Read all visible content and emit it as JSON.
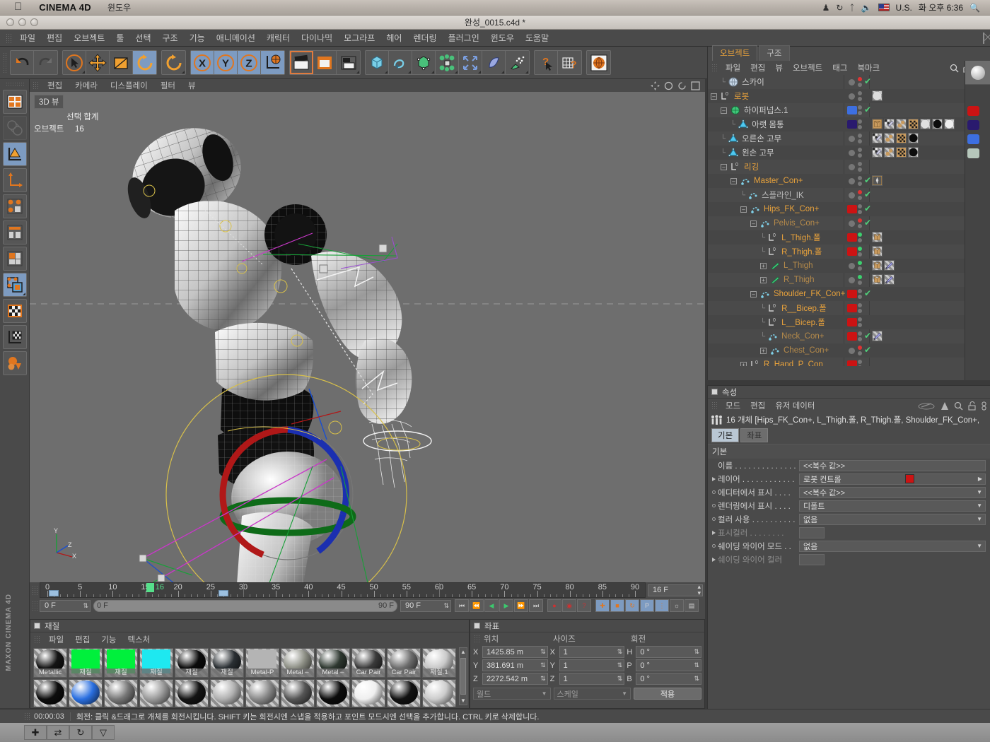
{
  "osx": {
    "apple_icon": "apple-icon",
    "app_name": "CINEMA 4D",
    "menu": [
      "윈도우"
    ],
    "status_icons": [
      "security-icon",
      "sync-icon",
      "bluetooth-icon",
      "volume-icon"
    ],
    "input_source": "U.S.",
    "clock": "화 오후 6:36",
    "spotlight": "search-icon"
  },
  "window": {
    "title": "완성_0015.c4d *"
  },
  "main_menu": [
    "파일",
    "편집",
    "오브젝트",
    "툴",
    "선택",
    "구조",
    "기능",
    "애니메이션",
    "캐릭터",
    "다이나믹",
    "모그라프",
    "헤어",
    "렌더링",
    "플러그인",
    "윈도우",
    "도움말"
  ],
  "toolbar": {
    "groups": [
      {
        "buttons": [
          {
            "name": "undo-icon",
            "state": "normal"
          },
          {
            "name": "redo-icon",
            "state": "disabled"
          }
        ]
      },
      {
        "buttons": [
          {
            "name": "select-tool-icon",
            "state": "normal"
          },
          {
            "name": "move-tool-icon",
            "state": "normal"
          },
          {
            "name": "scale-tool-icon",
            "state": "normal"
          },
          {
            "name": "rotate-tool-icon",
            "state": "active"
          }
        ]
      },
      {
        "buttons": [
          {
            "name": "rotate-alt-icon",
            "state": "normal"
          }
        ]
      },
      {
        "buttons": [
          {
            "name": "axis-x-icon",
            "state": "active"
          },
          {
            "name": "axis-y-icon",
            "state": "active"
          },
          {
            "name": "axis-z-icon",
            "state": "active"
          },
          {
            "name": "world-coordinate-icon",
            "state": "active"
          }
        ]
      },
      {
        "buttons": [
          {
            "name": "render-view-icon",
            "state": "highlight"
          },
          {
            "name": "render-region-icon",
            "state": "normal"
          },
          {
            "name": "render-settings-icon",
            "state": "normal"
          }
        ]
      },
      {
        "buttons": [
          {
            "name": "cube-primitive-icon",
            "state": "normal"
          },
          {
            "name": "spline-icon",
            "state": "normal"
          },
          {
            "name": "nurbs-icon",
            "state": "normal"
          },
          {
            "name": "array-icon",
            "state": "normal"
          },
          {
            "name": "deformer-icon",
            "state": "normal"
          },
          {
            "name": "environment-icon",
            "state": "normal"
          },
          {
            "name": "particles-icon",
            "state": "normal"
          }
        ]
      },
      {
        "buttons": [
          {
            "name": "help-cursor-icon",
            "state": "normal"
          },
          {
            "name": "layout-help-icon",
            "state": "normal"
          }
        ]
      },
      {
        "buttons": [
          {
            "name": "web-icon",
            "state": "normal"
          }
        ]
      }
    ]
  },
  "left_toolbar": [
    {
      "name": "layout-icon",
      "state": "normal"
    },
    {
      "name": "global-local-icon",
      "state": "disabled"
    },
    {
      "name": "model-mode-icon",
      "state": "active"
    },
    {
      "name": "object-axis-icon",
      "state": "normal"
    },
    {
      "name": "point-mode-icon",
      "state": "normal"
    },
    {
      "name": "edge-mode-icon",
      "state": "normal"
    },
    {
      "name": "polygon-mode-icon",
      "state": "normal"
    },
    {
      "name": "animation-mode-icon",
      "state": "active"
    },
    {
      "name": "texture-mode-icon",
      "state": "normal"
    },
    {
      "name": "texture-axis-icon",
      "state": "normal"
    },
    {
      "name": "workplane-icon",
      "state": "normal"
    }
  ],
  "maxon_logo": "MAXON CINEMA 4D",
  "viewport": {
    "menu": [
      "편집",
      "카메라",
      "디스플레이",
      "필터",
      "뷰"
    ],
    "label": "3D 뷰",
    "stats": {
      "header": "선택 합계",
      "rows": [
        {
          "key": "오브젝트",
          "value": "16"
        }
      ]
    },
    "axis_labels": [
      "Y",
      "X",
      "Z"
    ]
  },
  "timeline": {
    "ruler_ticks": [
      0,
      5,
      10,
      15,
      20,
      25,
      30,
      35,
      40,
      45,
      50,
      55,
      60,
      65,
      70,
      75,
      80,
      85,
      90
    ],
    "current_frame_label": "16",
    "current_frame_value": 16,
    "range_start": 0,
    "range_end": 90,
    "markers": [
      1,
      27
    ],
    "frame_field": "16 F",
    "start_field": "0 F",
    "preview_start": "0 F",
    "preview_end": "90 F",
    "end_field": "90 F",
    "transport": [
      "go-to-start-icon",
      "step-back-icon",
      "play-back-icon",
      "play-forward-icon",
      "step-forward-icon",
      "go-to-end-icon"
    ],
    "record": [
      "record-keyframe-icon",
      "autokey-icon",
      "keyframe-selection-icon"
    ],
    "keyflags": [
      "position-key-icon",
      "scale-key-icon",
      "rotation-key-icon",
      "param-key-icon",
      "point-level-key-icon",
      "animation-layer-icon",
      "keyframe-preset-icon"
    ]
  },
  "material_manager": {
    "title": "재질",
    "menu": [
      "파일",
      "편집",
      "기능",
      "텍스처"
    ],
    "rows": [
      [
        {
          "name": "Metallic",
          "type": "ball",
          "color": "#141414",
          "spec": "strong"
        },
        {
          "name": "재질",
          "type": "flat",
          "color": "#00f03c"
        },
        {
          "name": "재질",
          "type": "flat",
          "color": "#00f03c"
        },
        {
          "name": "재질",
          "type": "flat",
          "color": "#1ee8f0"
        },
        {
          "name": "재질",
          "type": "ball",
          "color": "#0b0b0b"
        },
        {
          "name": "재질",
          "type": "ball",
          "color": "#2a2f33"
        },
        {
          "name": "Metal-P",
          "type": "flat",
          "color": "#b4b4b4"
        },
        {
          "name": "Metal –",
          "type": "ball",
          "color": "#8d8f85"
        },
        {
          "name": "Metal –",
          "type": "ball",
          "color": "#2e3830"
        },
        {
          "name": "Car Pair",
          "type": "ball",
          "color": "#3a3a3a"
        },
        {
          "name": "Car Pair",
          "type": "ball",
          "color": "#6d6d6d"
        },
        {
          "name": "재질.1",
          "type": "ball",
          "color": "#c9c9c9"
        }
      ],
      [
        {
          "name": "",
          "type": "ball",
          "color": "#0d0d0d"
        },
        {
          "name": "",
          "type": "ball",
          "color": "#2a6fe0"
        },
        {
          "name": "",
          "type": "ball",
          "color": "#777777"
        },
        {
          "name": "",
          "type": "ball",
          "color": "#9a9a9a"
        },
        {
          "name": "",
          "type": "ball",
          "color": "#141414"
        },
        {
          "name": "",
          "type": "ball",
          "color": "#b0b0b0"
        },
        {
          "name": "",
          "type": "ball",
          "color": "#8a8a8a"
        },
        {
          "name": "",
          "type": "ball",
          "color": "#555555"
        },
        {
          "name": "",
          "type": "ball",
          "color": "#0c0c0c"
        },
        {
          "name": "",
          "type": "ball",
          "color": "#efefef"
        },
        {
          "name": "",
          "type": "ball",
          "color": "#121212"
        },
        {
          "name": "",
          "type": "ball",
          "color": "#cccccc"
        }
      ]
    ]
  },
  "coordinates": {
    "title": "좌표",
    "col_headers": [
      "위치",
      "사이즈",
      "회전"
    ],
    "position": {
      "x": "1425.85 m",
      "y": "381.691 m",
      "z": "2272.542 m"
    },
    "size": {
      "x": "1",
      "y": "1",
      "z": "1"
    },
    "rotation": {
      "h": "0 °",
      "p": "0 °",
      "b": "0 °"
    },
    "axis_labels": {
      "pos": [
        "X",
        "Y",
        "Z"
      ],
      "size": [
        "X",
        "Y",
        "Z"
      ],
      "rot": [
        "H",
        "P",
        "B"
      ]
    },
    "system_dropdown": "월드",
    "mode_dropdown": "스케일",
    "apply_button": "적용"
  },
  "object_manager": {
    "tabs": [
      {
        "label": "오브젝트",
        "active": true
      },
      {
        "label": "구조",
        "active": false
      }
    ],
    "menu": [
      "파일",
      "편집",
      "뷰",
      "오브젝트",
      "태그",
      "북마크"
    ],
    "menu_icons": [
      "search-icon",
      "home-icon",
      "eye-icon"
    ],
    "rows": [
      {
        "name": "스카이",
        "icon": "sky-icon",
        "indent": 1,
        "color": "#cfcfcf",
        "expander": "none",
        "chip": "none",
        "dots": "red",
        "check": true,
        "tags": []
      },
      {
        "name": "로봇",
        "icon": "null-object-icon",
        "indent": 0,
        "color": "#e8a23c",
        "expander": "minus",
        "chip": "none",
        "dots": "gray",
        "check": false,
        "tags": [
          "material-sphere"
        ]
      },
      {
        "name": "하이퍼넙스.1",
        "icon": "hypernurbs-icon",
        "indent": 1,
        "color": "#cfcfcf",
        "expander": "minus",
        "chip": "#3d6fe0",
        "dots": "gray",
        "check": true,
        "tags": []
      },
      {
        "name": "아랫 몸통",
        "icon": "polygon-object-icon",
        "indent": 2,
        "color": "#cfcfcf",
        "expander": "none",
        "chip": "#2a1a6e",
        "dots": "gray",
        "check": false,
        "tags": [
          "phong-icon",
          "texture-icon",
          "dot-pair-icon",
          "checker-icon",
          "mat-white",
          "mat-black",
          "mat-white2"
        ]
      },
      {
        "name": "오른손 고무",
        "icon": "polygon-object-icon",
        "indent": 1,
        "color": "#cfcfcf",
        "expander": "none",
        "chip": "none",
        "dots": "gray",
        "check": false,
        "tags": [
          "texture-icon",
          "dot-pair-icon",
          "checker-icon",
          "mat-black"
        ]
      },
      {
        "name": "왼손 고무",
        "icon": "polygon-object-icon",
        "indent": 1,
        "color": "#cfcfcf",
        "expander": "none",
        "chip": "none",
        "dots": "gray",
        "check": false,
        "tags": [
          "texture-icon",
          "dot-pair-icon",
          "checker-icon",
          "mat-black"
        ]
      },
      {
        "name": "리깅",
        "icon": "null-object-icon",
        "indent": 1,
        "color": "#e8a23c",
        "expander": "minus",
        "chip": "none",
        "dots": "gray",
        "check": false,
        "tags": []
      },
      {
        "name": "Master_Con+",
        "icon": "joint-icon",
        "indent": 2,
        "color": "#e8a23c",
        "expander": "minus",
        "chip": "none",
        "dots": "gray",
        "check": true,
        "tags": [
          "xpresso-icon"
        ]
      },
      {
        "name": "스플라인_IK",
        "icon": "joint-icon",
        "indent": 3,
        "color": "#bdbdbd",
        "expander": "none",
        "chip": "none",
        "dots": "red",
        "check": true,
        "tags": []
      },
      {
        "name": "Hips_FK_Con+",
        "icon": "joint-icon",
        "indent": 3,
        "color": "#e8a23c",
        "expander": "minus",
        "chip": "#cc1313",
        "dots": "gray",
        "check": true,
        "tags": []
      },
      {
        "name": "Pelvis_Con+",
        "icon": "joint-icon",
        "indent": 4,
        "color": "#b58a4a",
        "expander": "minus",
        "chip": "none",
        "dots": "red",
        "check": true,
        "tags": []
      },
      {
        "name": "L_Thigh.폴",
        "icon": "null-object-icon",
        "indent": 5,
        "color": "#e8a23c",
        "expander": "none",
        "chip": "#cc1313",
        "dots": "green",
        "check": false,
        "tags": [
          "constraint-icon"
        ]
      },
      {
        "name": "R_Thigh.폴",
        "icon": "null-object-icon",
        "indent": 5,
        "color": "#e8a23c",
        "expander": "none",
        "chip": "#cc1313",
        "dots": "green",
        "check": false,
        "tags": [
          "constraint-icon"
        ]
      },
      {
        "name": "L_Thigh",
        "icon": "bone-icon",
        "indent": 5,
        "color": "#b58a4a",
        "expander": "plus",
        "chip": "none",
        "dots": "green",
        "check": false,
        "tags": [
          "constraint-icon",
          "ik-icon"
        ]
      },
      {
        "name": "R_Thigh",
        "icon": "bone-icon",
        "indent": 5,
        "color": "#b58a4a",
        "expander": "plus",
        "chip": "none",
        "dots": "green",
        "check": false,
        "tags": [
          "constraint-icon",
          "ik-icon"
        ]
      },
      {
        "name": "Shoulder_FK_Con+",
        "icon": "joint-icon",
        "indent": 4,
        "color": "#e8a23c",
        "expander": "minus",
        "chip": "#cc1313",
        "dots": "gray",
        "check": true,
        "tags": []
      },
      {
        "name": "R__Bicep.폴",
        "icon": "null-object-icon",
        "indent": 5,
        "color": "#e8a23c",
        "expander": "none",
        "chip": "#cc1313",
        "dots": "gray",
        "check": false,
        "tags": []
      },
      {
        "name": "L__Bicep.폴",
        "icon": "null-object-icon",
        "indent": 5,
        "color": "#e8a23c",
        "expander": "none",
        "chip": "#cc1313",
        "dots": "gray",
        "check": false,
        "tags": []
      },
      {
        "name": "Neck_Con+",
        "icon": "joint-icon",
        "indent": 5,
        "color": "#b58a4a",
        "expander": "none",
        "chip": "#cc1313",
        "dots": "gray",
        "check": true,
        "tags": [
          "ik-icon"
        ]
      },
      {
        "name": "Chest_Con+",
        "icon": "joint-icon",
        "indent": 5,
        "color": "#b58a4a",
        "expander": "plus",
        "chip": "none",
        "dots": "red",
        "check": true,
        "tags": []
      },
      {
        "name": "R_Hand_P_Con",
        "icon": "null-object-icon",
        "indent": 3,
        "color": "#e8a23c",
        "expander": "plus",
        "chip": "#cc1313",
        "dots": "gray",
        "check": false,
        "tags": []
      }
    ],
    "layer_swatches": [
      "#cc1313",
      "#2a1a6e",
      "#3d6fe0",
      "#b6c7bb"
    ]
  },
  "attribute_manager": {
    "title": "속성",
    "menu": [
      "모드",
      "편집",
      "유저 데이터"
    ],
    "menu_icons": [
      "history-icon",
      "pin-icon",
      "search-icon",
      "lock-icon",
      "link-icon"
    ],
    "selection_summary": "16 개체 [Hips_FK_Con+, L_Thigh.폴, R_Thigh.폴, Shoulder_FK_Con+,",
    "selection_icon": "multi-object-icon",
    "tabs": [
      {
        "label": "기본",
        "active": true
      },
      {
        "label": "좌표",
        "active": false
      }
    ],
    "section": "기본",
    "properties": [
      {
        "label": "이름 . . . . . . . . . . . . . .",
        "value": "<<복수 값>>",
        "type": "text",
        "marker": "none",
        "dim": false
      },
      {
        "label": "레이어 . . . . . . . . . . . .",
        "value": "로봇 컨트롤",
        "type": "layer",
        "marker": "tri",
        "dim": false,
        "swatch": "#cc1313"
      },
      {
        "label": "에디터에서 표시 . . . .",
        "value": "<<복수 값>>",
        "type": "dropdown",
        "marker": "dot",
        "dim": false
      },
      {
        "label": "렌더링에서 표시 . . . .",
        "value": "디폴트",
        "type": "dropdown",
        "marker": "dot",
        "dim": false
      },
      {
        "label": "컬러 사용 . . . . . . . . . .",
        "value": "없음",
        "type": "dropdown",
        "marker": "dot",
        "dim": false
      },
      {
        "label": "표시컬러 . . . . . . . .",
        "value": "",
        "type": "colorfield",
        "marker": "tri",
        "dim": true
      },
      {
        "label": "쉐이딩 와이어 모드 . .",
        "value": "없음",
        "type": "dropdown",
        "marker": "dot",
        "dim": false
      },
      {
        "label": "쉐이딩 와이어 컬러",
        "value": "",
        "type": "colorfield",
        "marker": "tri",
        "dim": true
      }
    ]
  },
  "status_bar": {
    "time": "00:00:03",
    "message": "회전: 클릭 &드래그로 개체를 회전시킵니다. SHIFT 키는 회전시엔 스냅을 적용하고 포인트 모드시엔 선택을 추가합니다. CTRL 키로 삭제합니다."
  },
  "bottom_bar": {
    "buttons": [
      "add-icon",
      "shuffle-icon",
      "loop-icon",
      "dropdown-icon"
    ]
  },
  "colors": {
    "accent_orange": "#e8a23c",
    "panel_bg": "#4a4a4a",
    "viewport_bg": "#6e6e6e",
    "active_blue": "#7d9bc1",
    "layer_red": "#cc1313"
  }
}
